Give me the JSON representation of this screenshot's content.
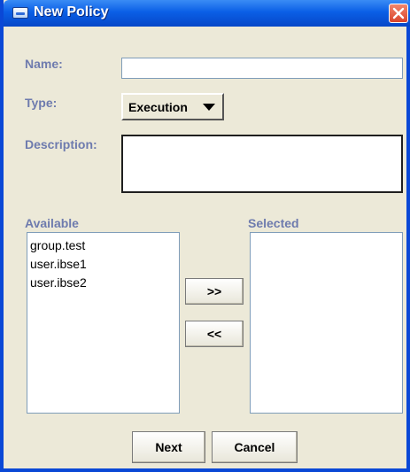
{
  "window": {
    "title": "New Policy"
  },
  "form": {
    "name_label": "Name:",
    "name_value": "",
    "type_label": "Type:",
    "type_value": "Execution",
    "description_label": "Description:",
    "description_value": ""
  },
  "available": {
    "label": "Available",
    "items": [
      "group.test",
      "user.ibse1",
      "user.ibse2"
    ]
  },
  "selected": {
    "label": "Selected",
    "items": []
  },
  "buttons": {
    "add": ">>",
    "remove": "<<",
    "next": "Next",
    "cancel": "Cancel"
  },
  "icons": {
    "app": "window-app-icon",
    "close": "close-icon",
    "dropdown": "triangle-down-icon"
  },
  "colors": {
    "titlebar": "#0A5FE6",
    "label": "#6E7BAE",
    "background": "#ECE9D8",
    "close": "#D9442B"
  }
}
